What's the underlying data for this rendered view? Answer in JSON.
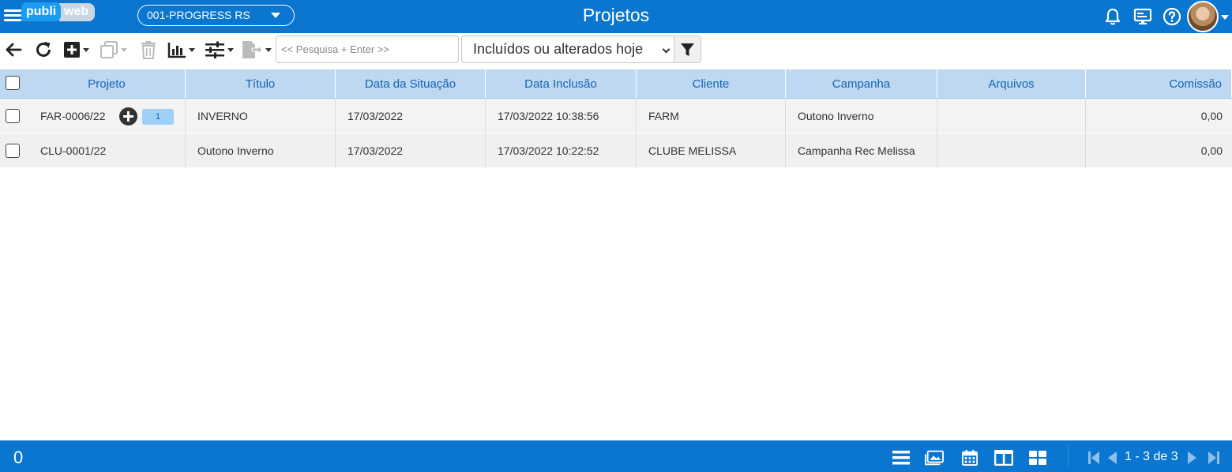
{
  "header": {
    "menu_icon": "hamburger-icon",
    "logo": {
      "left": "publi",
      "right": "web"
    },
    "company": "001-PROGRESS RS",
    "title": "Projetos",
    "icons": [
      "bell-icon",
      "monitor-icon",
      "help-icon",
      "user-avatar"
    ],
    "colors": {
      "primary": "#0a76d0",
      "header_row": "#bdd8f0",
      "link": "#1565b8"
    }
  },
  "toolbar": {
    "icons": [
      "back-arrow-icon",
      "refresh-icon",
      "add-icon",
      "copy-icon",
      "delete-icon",
      "chart-icon",
      "sliders-icon",
      "export-icon",
      "filter-icon"
    ],
    "search_placeholder": "<< Pesquisa + Enter >>",
    "filter_value": "Incluídos ou alterados hoje"
  },
  "table": {
    "columns": [
      "Projeto",
      "Título",
      "Data da Situação",
      "Data Inclusão",
      "Cliente",
      "Campanha",
      "Arquivos",
      "Comissão"
    ],
    "rows": [
      {
        "projeto": "FAR-0006/22",
        "badge": "1",
        "titulo": "INVERNO",
        "data_situacao": "17/03/2022",
        "data_inclusao": "17/03/2022 10:38:56",
        "cliente": "FARM",
        "campanha": "Outono Inverno",
        "arquivos": "",
        "comissao": "0,00"
      },
      {
        "projeto": "CLU-0001/22",
        "titulo": "Outono Inverno",
        "data_situacao": "17/03/2022",
        "data_inclusao": "17/03/2022 10:22:52",
        "cliente": "CLUBE MELISSA",
        "campanha": "Campanha Rec Melissa",
        "arquivos": "",
        "comissao": "0,00"
      }
    ]
  },
  "footer": {
    "selected_count": "0",
    "view_icons": [
      "list-view-icon",
      "gallery-view-icon",
      "calendar-view-icon",
      "columns-view-icon",
      "grid-view-icon"
    ],
    "pager_icons": [
      "first-page-icon",
      "prev-page-icon",
      "next-page-icon",
      "last-page-icon"
    ],
    "pager_text": "1 - 3 de 3"
  }
}
